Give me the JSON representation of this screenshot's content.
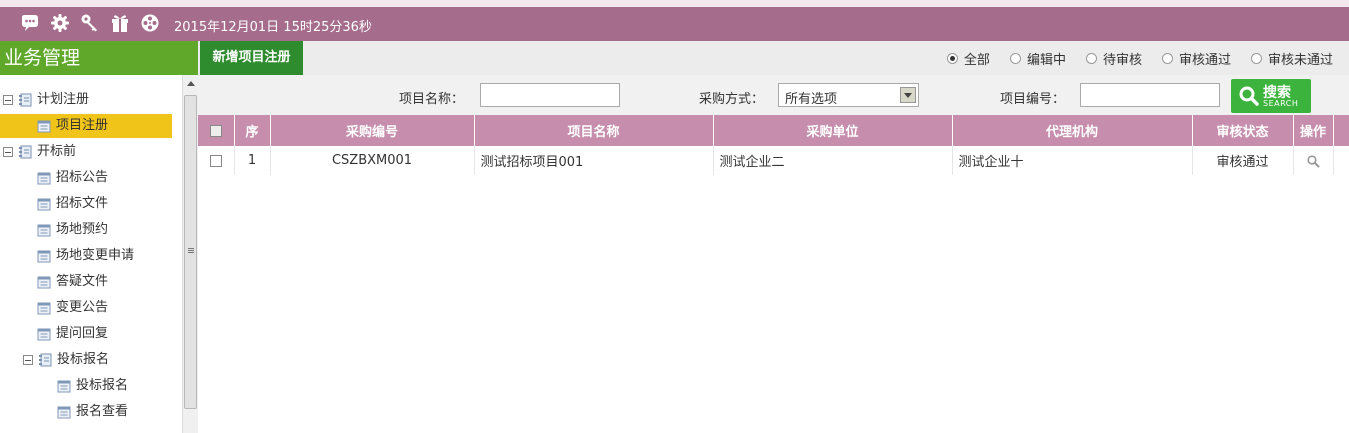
{
  "topbar": {
    "datetime": "2015年12月01日 15时25分36秒",
    "icons": [
      "chat-icon",
      "settings-icon",
      "key-icon",
      "gift-icon",
      "film-reel-icon"
    ]
  },
  "sidebar": {
    "title": "业务管理",
    "tree": [
      {
        "label": "计划注册",
        "type": "folder",
        "expanded": true
      },
      {
        "label": "项目注册",
        "type": "page",
        "selected": true
      },
      {
        "label": "开标前",
        "type": "folder",
        "expanded": true
      },
      {
        "label": "招标公告",
        "type": "page"
      },
      {
        "label": "招标文件",
        "type": "page"
      },
      {
        "label": "场地预约",
        "type": "page"
      },
      {
        "label": "场地变更申请",
        "type": "page"
      },
      {
        "label": "答疑文件",
        "type": "page"
      },
      {
        "label": "变更公告",
        "type": "page"
      },
      {
        "label": "提问回复",
        "type": "page"
      },
      {
        "label": "投标报名",
        "type": "folder",
        "expanded": true
      },
      {
        "label": "投标报名",
        "type": "page"
      },
      {
        "label": "报名查看",
        "type": "page"
      }
    ]
  },
  "toolbar": {
    "new_button": "新增项目注册",
    "status_filters": [
      {
        "label": "全部",
        "checked": true
      },
      {
        "label": "编辑中",
        "checked": false
      },
      {
        "label": "待审核",
        "checked": false
      },
      {
        "label": "审核通过",
        "checked": false
      },
      {
        "label": "审核未通过",
        "checked": false
      }
    ]
  },
  "search": {
    "project_name_label": "项目名称：",
    "project_name_value": "",
    "method_label": "采购方式：",
    "method_value": "所有选项",
    "project_no_label": "项目编号：",
    "project_no_value": "",
    "button_label": "搜索",
    "button_sub": "SEARCH"
  },
  "table": {
    "headers": [
      "序",
      "采购编号",
      "项目名称",
      "采购单位",
      "代理机构",
      "审核状态",
      "操作"
    ],
    "rows": [
      {
        "index": "1",
        "code": "CSZBXM001",
        "name": "测试招标项目001",
        "unit": "测试企业二",
        "agency": "测试企业十",
        "status": "审核通过",
        "action_icon": "magnifier-icon"
      }
    ]
  },
  "colors": {
    "topbar": "#a56c8c",
    "sidebar_header": "#5fa82a",
    "new_button": "#2e8b2e",
    "table_header": "#c68eac",
    "selected_node": "#f0c419",
    "search_button": "#3cb33c"
  }
}
